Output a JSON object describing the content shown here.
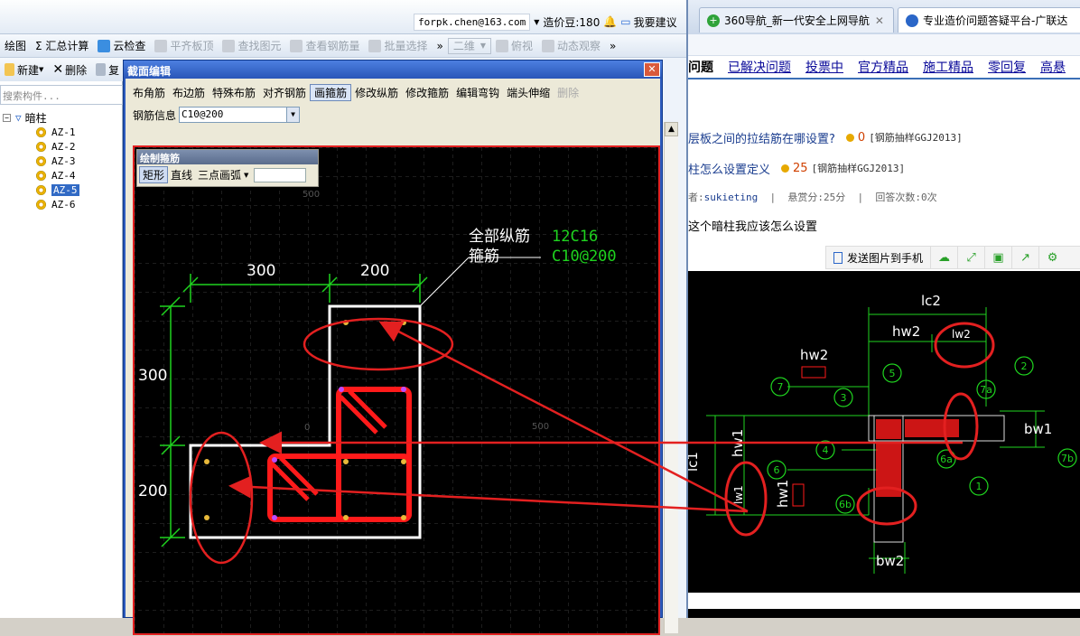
{
  "titlebar": {
    "account": "forpk.chen@163.com",
    "cost_label": "造价豆:180",
    "suggest": "我要建议"
  },
  "toolbar1": [
    {
      "label": "绘图",
      "icon": "draw-icon",
      "enabled": true
    },
    {
      "label": "Σ 汇总计算",
      "icon": "",
      "enabled": true
    },
    {
      "label": "云检查",
      "icon": "cloud-check-icon",
      "enabled": true
    },
    {
      "label": "平齐板顶",
      "icon": "flush-icon",
      "enabled": false
    },
    {
      "label": "查找图元",
      "icon": "binoculars-icon",
      "enabled": false
    },
    {
      "label": "查看钢筋量",
      "icon": "rebar-view-icon",
      "enabled": false
    },
    {
      "label": "批量选择",
      "icon": "batch-select-icon",
      "enabled": false
    },
    {
      "label": "»",
      "icon": "",
      "enabled": true
    },
    {
      "label": "二维",
      "icon": "",
      "enabled": false
    },
    {
      "label": "俯视",
      "icon": "top-view-icon",
      "enabled": false
    },
    {
      "label": "动态观察",
      "icon": "orbit-icon",
      "enabled": false
    },
    {
      "label": "»",
      "icon": "",
      "enabled": true
    }
  ],
  "toolbar2": {
    "new": "新建",
    "delete": "删除",
    "copy": "复"
  },
  "search": {
    "placeholder": "搜索构件..."
  },
  "tree": {
    "root": "暗柱",
    "items": [
      "AZ-1",
      "AZ-2",
      "AZ-3",
      "AZ-4",
      "AZ-5",
      "AZ-6"
    ],
    "selected": "AZ-5"
  },
  "dialog": {
    "title": "截面编辑",
    "tools": [
      "布角筋",
      "布边筋",
      "特殊布筋",
      "对齐钢筋",
      "画箍筋",
      "修改纵筋",
      "修改箍筋",
      "编辑弯钩",
      "端头伸缩",
      "删除"
    ],
    "active_tool": "画箍筋",
    "rebar_info_label": "钢筋信息",
    "rebar_info_value": "C10@200",
    "draw_panel": {
      "title": "绘制箍筋",
      "options": [
        "矩形",
        "直线",
        "三点画弧"
      ],
      "selected": "矩形"
    }
  },
  "drawing": {
    "dim_top_left": "300",
    "dim_top_right": "200",
    "dim_left_top": "300",
    "dim_left_bottom": "200",
    "label_long": "全部纵筋",
    "label_stirrup": "箍筋",
    "value_long": "12C16",
    "value_stirrup": "C10@200",
    "grid_label_a": "500",
    "grid_label_b": "0",
    "grid_label_c": "500"
  },
  "browser": {
    "tabs": [
      "360导航_新一代安全上网导航",
      "专业造价问题答疑平台-广联达"
    ],
    "subnav": [
      "问题",
      "已解决问题",
      "投票中",
      "官方精品",
      "施工精品",
      "零回复",
      "高悬"
    ],
    "questions": [
      {
        "title": "层板之间的拉结筋在哪设置?",
        "reward": "0",
        "tag": "[钢筋抽样GGJ2013]"
      },
      {
        "title": "柱怎么设置定义",
        "reward": "25",
        "tag": "[钢筋抽样GGJ2013]"
      }
    ],
    "meta": {
      "asker_label": "者:",
      "asker": "sukieting",
      "reward": "悬赏分:25分",
      "answers": "回答次数:0次"
    },
    "question_text": "这个暗柱我应该怎么设置",
    "send_to_phone": "发送图片到手机"
  },
  "cad": {
    "lc2": "lc2",
    "hw2": "hw2",
    "lw2": "lw2",
    "hw2b": "hw2",
    "lc1": "lc1",
    "hw1": "hw1",
    "lw1": "lw1",
    "hw1b": "hw1",
    "bw1": "bw1",
    "bw2": "bw2",
    "markers": [
      "7",
      "5",
      "3",
      "2",
      "7a",
      "4",
      "6a",
      "6",
      "1",
      "7b",
      "6b"
    ]
  },
  "colors": {
    "accent": "#2d5bbf",
    "annot": "#e32020",
    "dim": "#1fd41f"
  }
}
